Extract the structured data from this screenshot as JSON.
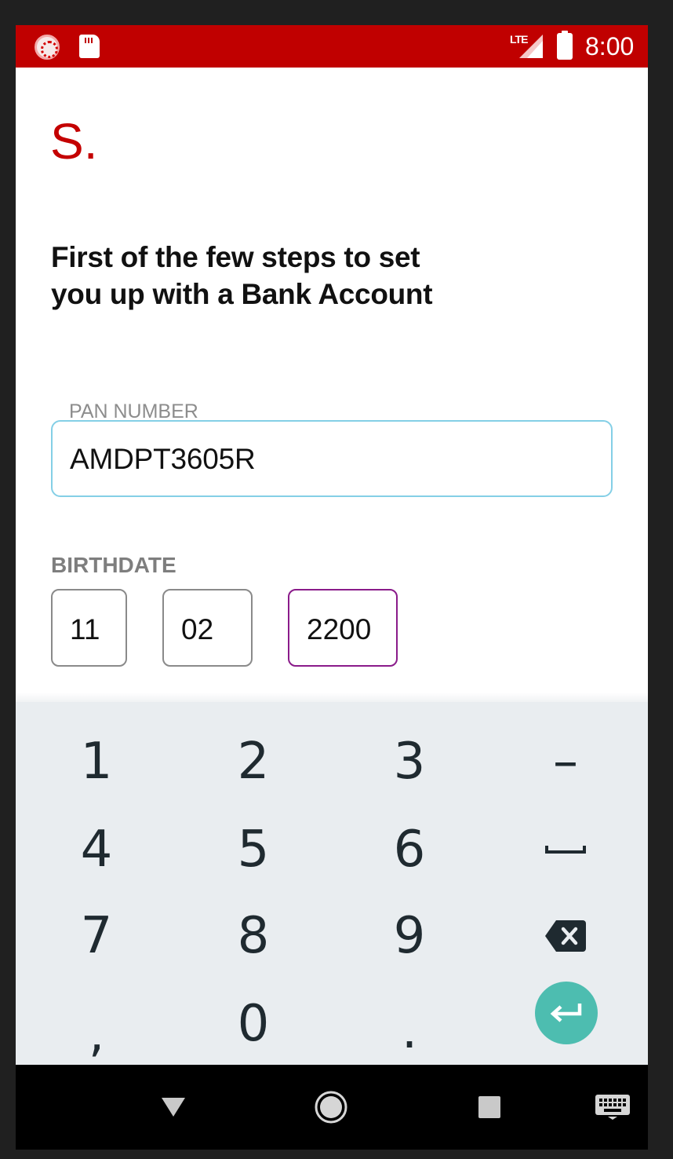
{
  "status_bar": {
    "network": "LTE",
    "time": "8:00",
    "colors": {
      "background": "#c00000"
    },
    "icons": [
      "app-notification-icon",
      "sd-card-icon",
      "signal-icon",
      "battery-icon"
    ]
  },
  "logo": {
    "text": "S."
  },
  "headline": {
    "line1": "First of the few steps to set",
    "line2": "you up with a Bank Account"
  },
  "pan": {
    "label": "PAN NUMBER",
    "value": "AMDPT3605R"
  },
  "birthdate": {
    "label": "BIRTHDATE",
    "day": "11",
    "month": "02",
    "year": "2200"
  },
  "keyboard": {
    "rows": [
      [
        "1",
        "2",
        "3",
        "–"
      ],
      [
        "4",
        "5",
        "6",
        "space"
      ],
      [
        "7",
        "8",
        "9",
        "backspace"
      ],
      [
        ",",
        "0",
        ".",
        "enter"
      ]
    ],
    "accent_color": "#4dbdb0"
  },
  "nav_bar": {
    "icons": [
      "back-icon",
      "home-icon",
      "recents-icon",
      "keyboard-switch-icon"
    ]
  }
}
